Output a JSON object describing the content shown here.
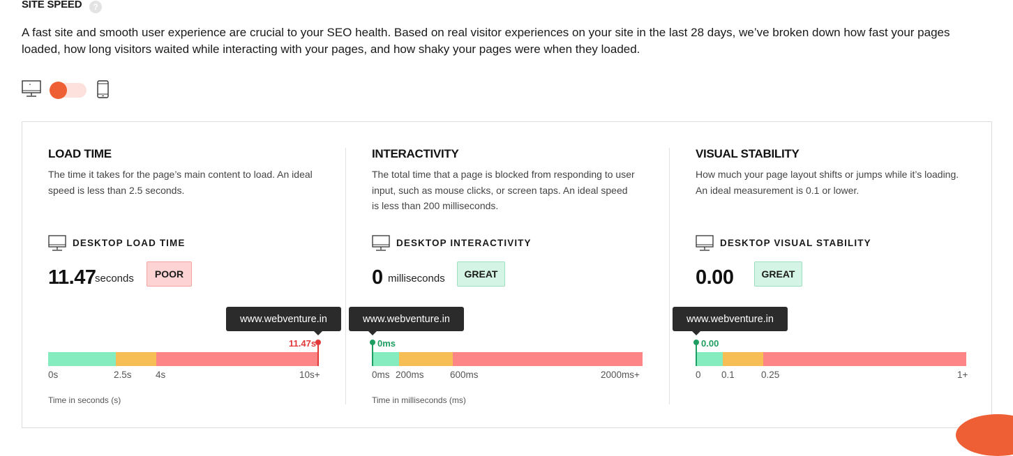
{
  "header": {
    "title": "SITE SPEED",
    "help": "?",
    "intro": "A fast site and smooth user experience are crucial to your SEO health. Based on real visitor experiences on your site in the last 28 days, we’ve broken down how fast your pages loaded, how long visitors waited while interacting with your pages, and how shaky your pages were when they loaded."
  },
  "device_toggle": {
    "selected": "desktop",
    "left_icon": "desktop-icon",
    "right_icon": "mobile-icon",
    "accent": "#ee5f36"
  },
  "columns": [
    {
      "title": "LOAD TIME",
      "description": "The time it takes for the page’s main content to load. An ideal speed is less than 2.5 seconds.",
      "metric_label": "DESKTOP LOAD TIME",
      "value": "11.47",
      "unit": "seconds",
      "badge": "POOR",
      "tooltip": "www.webventure.in",
      "marker_label": "11.47s",
      "ticks": [
        "0s",
        "2.5s",
        "4s",
        "10s+"
      ],
      "axis_note": "Time in seconds (s)"
    },
    {
      "title": "INTERACTIVITY",
      "description": "The total time that a page is blocked from responding to user input, such as mouse clicks, or screen taps. An ideal speed is less than 200 milliseconds.",
      "metric_label": "DESKTOP INTERACTIVITY",
      "value": "0",
      "unit": "milliseconds",
      "badge": "GREAT",
      "tooltip": "www.webventure.in",
      "marker_label": "0ms",
      "ticks": [
        "0ms",
        "200ms",
        "600ms",
        "2000ms+"
      ],
      "axis_note": "Time in milliseconds (ms)"
    },
    {
      "title": "VISUAL STABILITY",
      "description": "How much your page layout shifts or jumps while it’s loading. An ideal measurement is 0.1 or lower.",
      "metric_label": "DESKTOP VISUAL STABILITY",
      "value": "0.00",
      "unit": "",
      "badge": "GREAT",
      "tooltip": "www.webventure.in",
      "marker_label": "0.00",
      "ticks": [
        "0",
        "0.1",
        "0.25",
        "1+"
      ],
      "axis_note": ""
    }
  ],
  "colors": {
    "good": "#85ecc0",
    "needs_improvement": "#f7be56",
    "poor": "#fd8585",
    "marker_poor": "#e23a3a",
    "marker_good": "#1f9e62"
  }
}
